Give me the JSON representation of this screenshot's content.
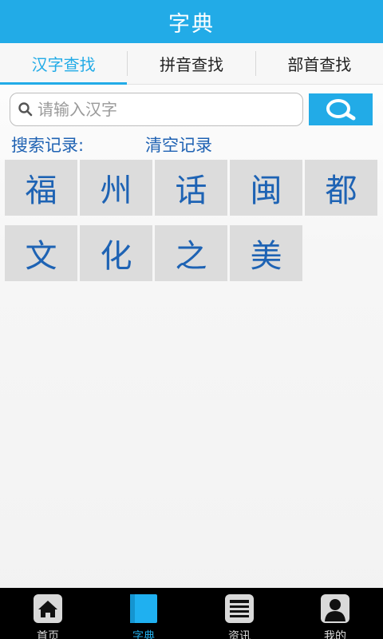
{
  "header": {
    "title": "字典"
  },
  "tabs": [
    {
      "label": "汉字查找",
      "active": true
    },
    {
      "label": "拼音查找",
      "active": false
    },
    {
      "label": "部首查找",
      "active": false
    }
  ],
  "search": {
    "placeholder": "请输入汉字",
    "value": ""
  },
  "history": {
    "label": "搜索记录:",
    "clear_label": "清空记录"
  },
  "history_chars": [
    "福",
    "州",
    "话",
    "闽",
    "都",
    "文",
    "化",
    "之",
    "美"
  ],
  "bottom_nav": [
    {
      "label": "首页",
      "icon": "home-icon",
      "active": false
    },
    {
      "label": "字典",
      "icon": "book-icon",
      "active": true
    },
    {
      "label": "资讯",
      "icon": "news-icon",
      "active": false
    },
    {
      "label": "我的",
      "icon": "user-icon",
      "active": false
    }
  ],
  "colors": {
    "accent": "#22abe7",
    "char_text": "#1e63b4",
    "cell_bg": "#dcdcdc",
    "nav_bg": "#000000"
  }
}
